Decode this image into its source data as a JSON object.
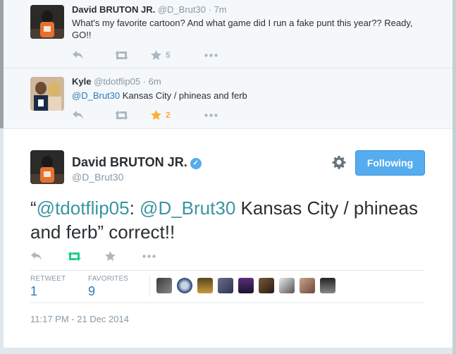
{
  "tweets": [
    {
      "name": "David BRUTON JR.",
      "handle": "@D_Brut30",
      "time": "7m",
      "text": "What's my favorite cartoon? And what game did I run a fake punt this year?? Ready, GO!!",
      "favorites": "5"
    },
    {
      "name": "Kyle",
      "handle": "@tdotflip05",
      "time": "6m",
      "mention": "@D_Brut30",
      "text": " Kansas City / phineas and ferb",
      "favorites": "2"
    }
  ],
  "main": {
    "name": "David BRUTON JR.",
    "handle": "@D_Brut30",
    "follow_label": "Following",
    "quote_open": "“",
    "mention1": "@tdotflip05",
    "colon": ": ",
    "mention2": "@D_Brut30",
    "text_rest": " Kansas City / phineas and ferb” correct!!",
    "retweets_label": "RETWEET",
    "retweets_value": "1",
    "favorites_label": "FAVORITES",
    "favorites_value": "9",
    "timestamp": "11:17 PM - 21 Dec 2014"
  },
  "separator": "·",
  "colors": {
    "accent": "#55acee",
    "link": "#2b7bb9",
    "star_active": "#ffac33",
    "icon_gray": "#aab8c2",
    "retweet_green": "#19cf86"
  },
  "icons": [
    "reply-icon",
    "retweet-icon",
    "favorite-icon",
    "more-icon",
    "verified-icon",
    "gear-icon"
  ]
}
